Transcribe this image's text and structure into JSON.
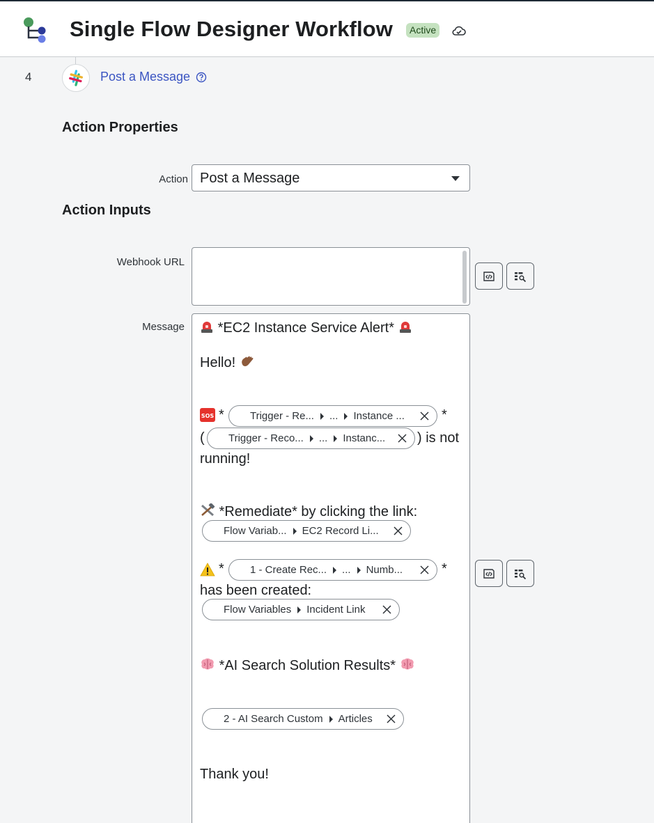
{
  "header": {
    "title": "Single Flow Designer Workflow",
    "status": "Active"
  },
  "step": {
    "number": "4",
    "name": "Post a Message"
  },
  "action_properties": {
    "heading": "Action Properties",
    "action_label": "Action",
    "action_value": "Post a Message"
  },
  "action_inputs": {
    "heading": "Action Inputs",
    "webhook_label": "Webhook URL",
    "message_label": "Message"
  },
  "message": {
    "line1": "*EC2 Instance Service Alert*",
    "line2": "Hello!",
    "star": "*",
    "paren_open": "(",
    "not_running_1": ") is not",
    "not_running_2": "running!",
    "remediate": "*Remediate* by clicking the link:",
    "created": "has been created:",
    "ai": "*AI Search Solution Results*",
    "thanks": "Thank you!"
  },
  "pills": {
    "p1": [
      "Trigger - Re...",
      "...",
      "Instance ..."
    ],
    "p2": [
      "Trigger - Reco...",
      "...",
      "Instanc..."
    ],
    "p3": [
      "Flow Variab...",
      "EC2 Record Li..."
    ],
    "p4": [
      "1 - Create Rec...",
      "...",
      "Numb..."
    ],
    "p5": [
      "Flow Variables",
      "Incident Link"
    ],
    "p6": [
      "2 - AI Search Custom",
      "Articles"
    ]
  },
  "colors": {
    "accent": "#3b55c2",
    "badge_bg": "#c5e2c0",
    "header_border": "#1e2a35"
  }
}
